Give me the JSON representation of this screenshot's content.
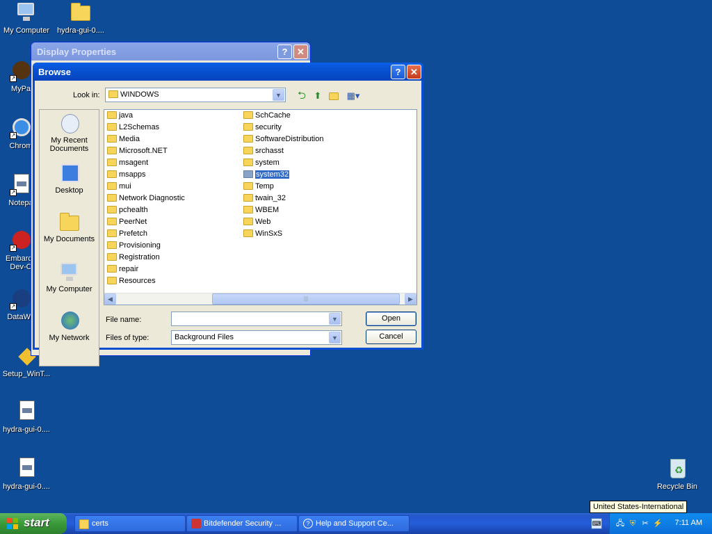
{
  "desktop": {
    "icons": [
      {
        "label": "My Computer"
      },
      {
        "label": "hydra-gui-0...."
      },
      {
        "label": "MyPa"
      },
      {
        "label": "Chrom"
      },
      {
        "label": "Notepa"
      },
      {
        "label": "Embarca Dev-C"
      },
      {
        "label": "DataWa"
      },
      {
        "label": "Setup_WinT..."
      },
      {
        "label": "hydra-gui-0...."
      },
      {
        "label": "hydra-gui-0...."
      },
      {
        "label": "Recycle Bin"
      }
    ]
  },
  "display_properties": {
    "title": "Display Properties",
    "help": "?",
    "close": "✕"
  },
  "browse": {
    "title": "Browse",
    "help": "?",
    "close": "✕",
    "look_in_label": "Look in:",
    "look_in_value": "WINDOWS",
    "places": [
      "My Recent Documents",
      "Desktop",
      "My Documents",
      "My Computer",
      "My Network"
    ],
    "files_col1": [
      "java",
      "L2Schemas",
      "Media",
      "Microsoft.NET",
      "msagent",
      "msapps",
      "mui",
      "Network Diagnostic",
      "pchealth",
      "PeerNet",
      "Prefetch",
      "Provisioning",
      "Registration",
      "repair",
      "Resources"
    ],
    "files_col2": [
      "SchCache",
      "security",
      "SoftwareDistribution",
      "srchasst",
      "system",
      "system32",
      "Temp",
      "twain_32",
      "WBEM",
      "Web",
      "WinSxS"
    ],
    "selected": "system32",
    "file_name_label": "File name:",
    "file_name_value": "",
    "files_of_type_label": "Files of type:",
    "files_of_type_value": "Background Files",
    "open_label": "Open",
    "cancel_label": "Cancel"
  },
  "taskbar": {
    "start_label": "start",
    "tasks": [
      "certs",
      "Bitdefender Security ...",
      "Help and Support Ce..."
    ],
    "clock": "7:11 AM",
    "tooltip": "United States-International"
  },
  "colors": {
    "desktop": "#0f4c98",
    "titlebar": "#0852d1",
    "selection": "#316ac5"
  }
}
